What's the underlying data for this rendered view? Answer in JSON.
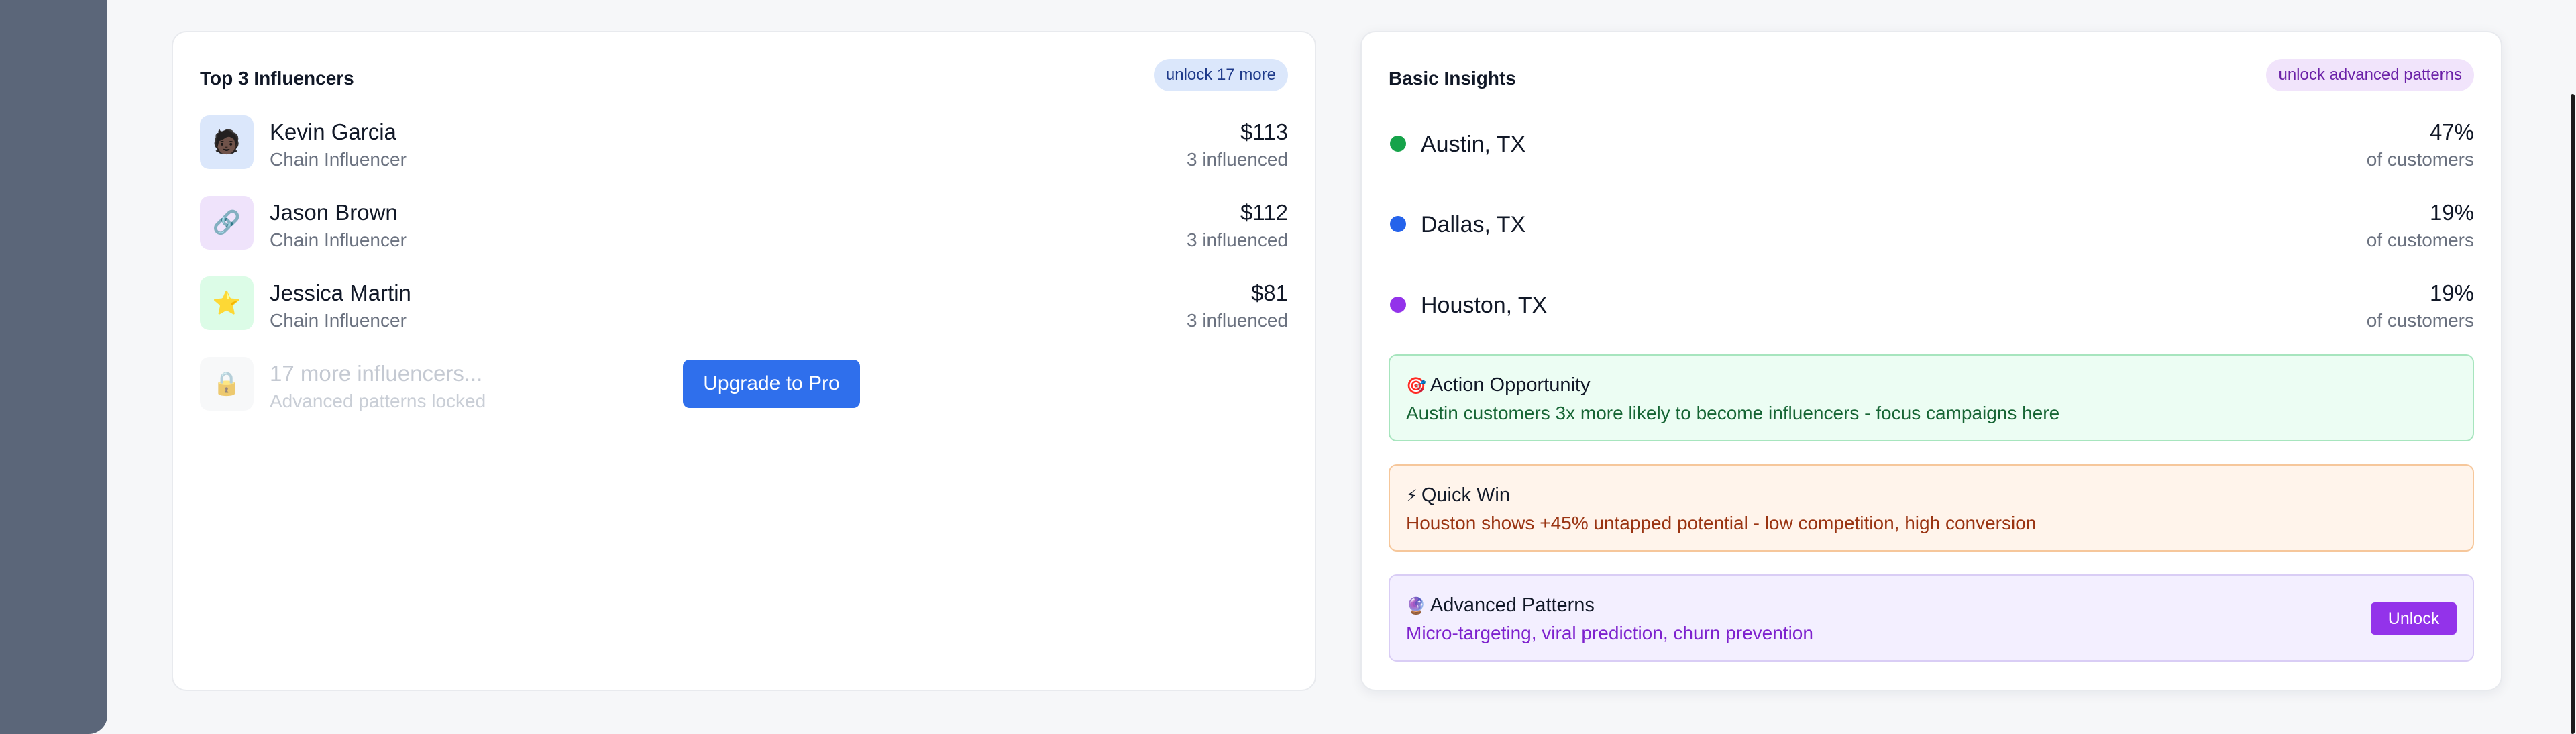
{
  "influencers_card": {
    "title": "Top 3 Influencers",
    "badge": "unlock 17 more",
    "items": [
      {
        "name": "Kevin Garcia",
        "role": "Chain Influencer",
        "value": "$113",
        "influenced": "3 influenced",
        "icon": "person-portrait-icon",
        "glyph": "🧑🏿",
        "bg": "#dbe7fb"
      },
      {
        "name": "Jason Brown",
        "role": "Chain Influencer",
        "value": "$112",
        "influenced": "3 influenced",
        "icon": "link-icon",
        "glyph": "🔗",
        "bg": "#efe3fb"
      },
      {
        "name": "Jessica Martin",
        "role": "Chain Influencer",
        "value": "$81",
        "influenced": "3 influenced",
        "icon": "star-icon",
        "glyph": "⭐",
        "bg": "#dcfce7"
      }
    ],
    "locked": {
      "name": "17 more influencers...",
      "sub": "Advanced patterns locked",
      "icon": "lock-icon",
      "glyph": "🔒"
    },
    "upgrade_label": "Upgrade to Pro"
  },
  "insights_card": {
    "title": "Basic Insights",
    "badge": "unlock advanced patterns",
    "locations": [
      {
        "name": "Austin, TX",
        "pct": "47%",
        "sub": "of customers",
        "color": "#16a34a"
      },
      {
        "name": "Dallas, TX",
        "pct": "19%",
        "sub": "of customers",
        "color": "#2563eb"
      },
      {
        "name": "Houston, TX",
        "pct": "19%",
        "sub": "of customers",
        "color": "#9333ea"
      }
    ],
    "action": {
      "icon": "target-icon",
      "glyph": "🎯",
      "title": "Action Opportunity",
      "desc": "Austin customers 3x more likely to become influencers - focus campaigns here"
    },
    "quickwin": {
      "icon": "lightning-icon",
      "glyph": "⚡",
      "title": "Quick Win",
      "desc": "Houston shows +45% untapped potential - low competition, high conversion"
    },
    "advanced": {
      "icon": "crystal-ball-icon",
      "glyph": "🔮",
      "title": "Advanced Patterns",
      "desc": "Micro-targeting, viral prediction, churn prevention",
      "button": "Unlock"
    }
  }
}
